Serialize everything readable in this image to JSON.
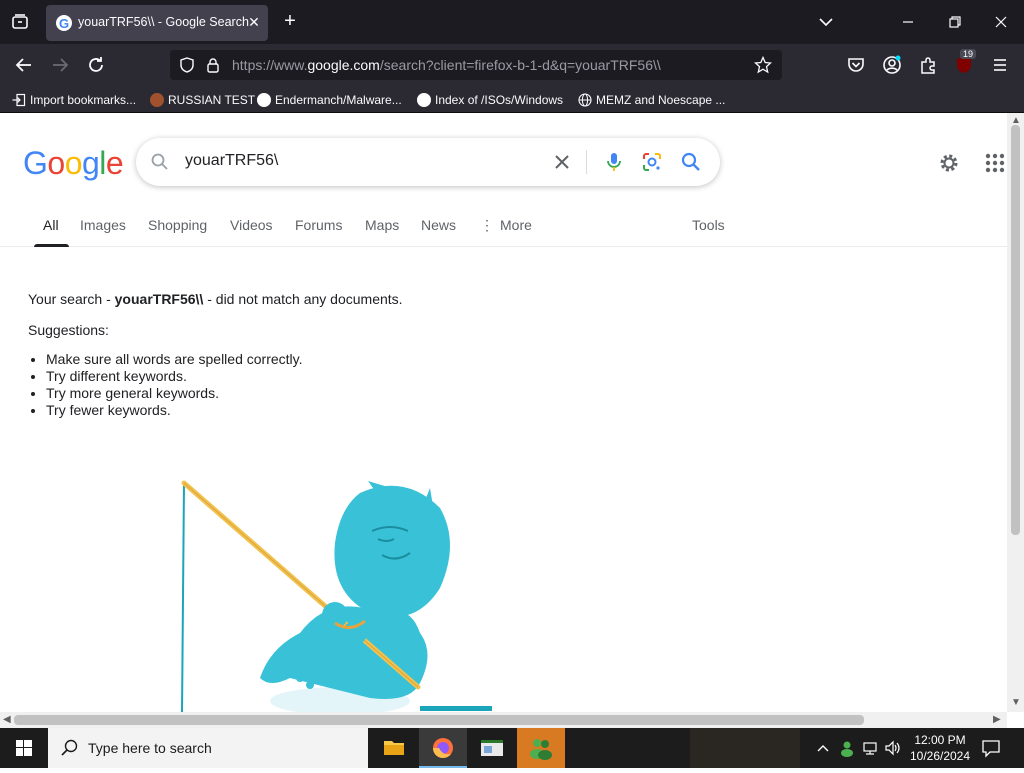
{
  "browser": {
    "tab_title": "youarTRF56\\\\ - Google Search",
    "url_prefix": "https://www.",
    "url_host": "google.com",
    "url_rest": "/search?client=firefox-b-1-d&q=youarTRF56\\\\",
    "extension_badge": "19",
    "bookmarks": [
      {
        "label": "Import bookmarks..."
      },
      {
        "label": "RUSSIAN TEST"
      },
      {
        "label": "Endermanch/Malware..."
      },
      {
        "label": "Index of /ISOs/Windows"
      },
      {
        "label": "MEMZ and Noescape ..."
      }
    ]
  },
  "google": {
    "logo_letters": [
      "G",
      "o",
      "o",
      "g",
      "l",
      "e"
    ],
    "logo_colors": [
      "#4285F4",
      "#EA4335",
      "#FBBC05",
      "#4285F4",
      "#34A853",
      "#EA4335"
    ],
    "query": "youarTRF56\\",
    "tabs": [
      {
        "label": "All",
        "active": true
      },
      {
        "label": "Images"
      },
      {
        "label": "Shopping"
      },
      {
        "label": "Videos"
      },
      {
        "label": "Forums"
      },
      {
        "label": "Maps"
      },
      {
        "label": "News"
      },
      {
        "label": "More"
      }
    ],
    "tools_label": "Tools",
    "no_results": {
      "prefix": "Your search - ",
      "term": "youarTRF56\\\\",
      "suffix": " - did not match any documents."
    },
    "suggestions_title": "Suggestions:",
    "suggestions": [
      "Make sure all words are spelled correctly.",
      "Try different keywords.",
      "Try more general keywords.",
      "Try fewer keywords."
    ]
  },
  "taskbar": {
    "search_placeholder": "Type here to search",
    "time": "12:00 PM",
    "date": "10/26/2024"
  },
  "colors": {
    "accent_blue": "#1a73e8",
    "mascot": "#39c2d7",
    "rod": "#f2c14e"
  }
}
